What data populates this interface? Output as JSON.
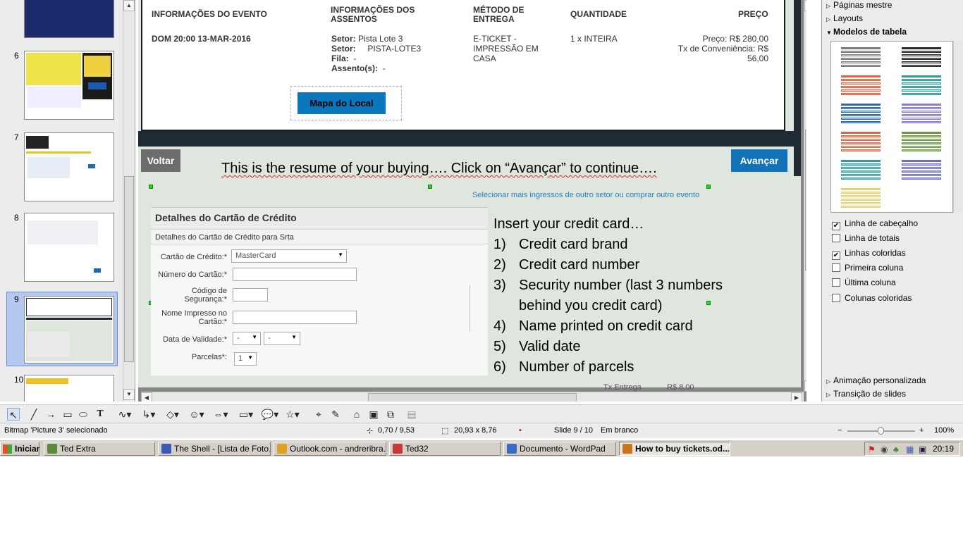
{
  "slide_panel": {
    "thumbnails": [
      {
        "num": "6"
      },
      {
        "num": "7"
      },
      {
        "num": "8"
      },
      {
        "num": "9"
      },
      {
        "num": "10"
      }
    ]
  },
  "ticket": {
    "col_event": "INFORMAÇÕES DO EVENTO",
    "col_seats": "INFORMAÇÕES DOS ASSENTOS",
    "col_delivery": "MÉTODO DE ENTREGA",
    "col_qty": "QUANTIDADE",
    "col_price": "PREÇO",
    "event_date": "DOM 20:00 13-MAR-2016",
    "setor1_label": "Setor:",
    "setor1_value": "Pista Lote 3",
    "setor2_label": "Setor:",
    "setor2_value": "PISTA-LOTE3",
    "fila_label": "Fila:",
    "fila_value": "-",
    "assento_label": "Assento(s):",
    "assento_value": "-",
    "delivery_value": "E-TICKET - IMPRESSÃO EM CASA",
    "qty_value": "1 x INTEIRA",
    "price_line": "Preço: R$ 280,00",
    "fee_line1": "Tx de Conveniência: R$",
    "fee_line2": "56,00",
    "map_button": "Mapa do Local"
  },
  "nav": {
    "back_button": "Voltar",
    "next_button": "Avançar",
    "resume_text": "This is the resume of your buying…. Click on “Avançar” to continue….",
    "select_more_link": "Selecionar mais ingressos de outro setor ou comprar outro evento"
  },
  "credit_card": {
    "title": "Detalhes do Cartão de Crédito",
    "subtitle": "Detalhes do Cartão de Crédito para Srta",
    "card_label": "Cartão de Crédito:*",
    "card_value": "MasterCard",
    "number_label": "Número do Cartão:*",
    "security_label_1": "Código de",
    "security_label_2": "Segurança:*",
    "name_label_1": "Nome Impresso no",
    "name_label_2": "Cartão:*",
    "validity_label": "Data de Validade:*",
    "validity_month": "-",
    "validity_year": "-",
    "parcels_label": "Parcelas*:",
    "parcels_value": "1"
  },
  "instructions": {
    "intro": "Insert your credit card…",
    "steps": [
      {
        "n": "1)",
        "text": "Credit card brand"
      },
      {
        "n": "2)",
        "text": "Credit card number"
      },
      {
        "n": "3)",
        "text": "Security number (last 3 numbers"
      },
      {
        "n": "",
        "text": "behind you credit card)"
      },
      {
        "n": "4)",
        "text": "Name printed on credit card"
      },
      {
        "n": "5)",
        "text": "Valid date"
      },
      {
        "n": "6)",
        "text": "Number of parcels"
      }
    ]
  },
  "footer_slide": {
    "tx_label": "Tx Entrega",
    "tx_value": "R$ 8,00"
  },
  "right_panel": {
    "master_pages": "Páginas mestre",
    "layouts": "Layouts",
    "table_models": "Modelos de tabela",
    "options": [
      {
        "label": "Linha de cabeçalho",
        "checked": true
      },
      {
        "label": "Linha de totais",
        "checked": false
      },
      {
        "label": "Linhas coloridas",
        "checked": true
      },
      {
        "label": "Primeira coluna",
        "checked": false
      },
      {
        "label": "Última coluna",
        "checked": false
      },
      {
        "label": "Colunas coloridas",
        "checked": false
      }
    ],
    "custom_animation": "Animação personalizada",
    "slide_transition": "Transição de slides",
    "table_colors": [
      "#7a7a7a",
      "#2a2a2a",
      "#e0603a",
      "#2a9a9a",
      "#2a6ab8",
      "#8a7ad8",
      "#d86a4a",
      "#6a9a3a",
      "#2aa0a0",
      "#6a6ad8",
      "#e8d070"
    ]
  },
  "status": {
    "selection": "Bitmap 'Picture 3' selecionado",
    "position": "0,70 / 9,53",
    "size": "20,93 x 8,76",
    "slide": "Slide 9 / 10",
    "layout": "Em branco",
    "zoom": "100%"
  },
  "taskbar": {
    "start": "Iniciar",
    "tasks": [
      {
        "label": "Ted Extra",
        "color": "#5a8a3a"
      },
      {
        "label": "The Shell - [Lista de Foto...",
        "color": "#3a5ab8"
      },
      {
        "label": "Outlook.com - andreribra...",
        "color": "#e0a020"
      },
      {
        "label": "Ted32",
        "color": "#c83a3a"
      },
      {
        "label": "Documento - WordPad",
        "color": "#3a6ac8"
      },
      {
        "label": "How to buy tickets.od...",
        "color": "#c8781a"
      }
    ],
    "clock": "20:19"
  }
}
